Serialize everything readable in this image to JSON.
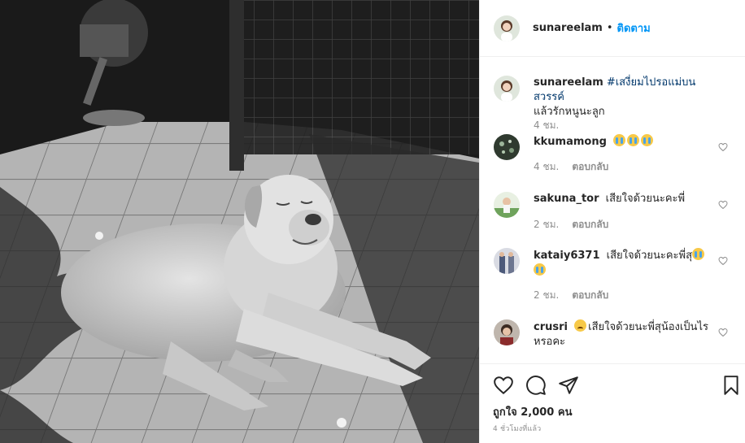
{
  "post": {
    "author": "sunareelam",
    "separator": "•",
    "follow_label": "ติดตาม",
    "caption": {
      "username": "sunareelam",
      "hashtag_line1": "#เสงี่ยมไปรอแม่บนสวรรค์",
      "line2": "แล้วรักหนูนะลูก",
      "time": "4 ชม."
    },
    "likes_text": "ถูกใจ 2,000 คน",
    "posted_ago": "4 ชั่วโมงที่แล้ว"
  },
  "comments": [
    {
      "username": "kkumamong",
      "text": "",
      "emojis": [
        "cry",
        "cry",
        "cry"
      ],
      "time": "4 ชม.",
      "reply_label": "ตอบกลับ"
    },
    {
      "username": "sakuna_tor",
      "text": "เสียใจด้วยนะคะพี่",
      "emojis": [],
      "time": "2 ชม.",
      "reply_label": "ตอบกลับ"
    },
    {
      "username": "kataiy6371",
      "text": "เสียใจด้วยนะคะพี่สุ",
      "emojis": [
        "cry",
        "cry"
      ],
      "time": "2 ชม.",
      "reply_label": "ตอบกลับ"
    },
    {
      "username": "crusri",
      "text_line1": "เสียใจด้วยนะพี่สุน้องเป็นไร",
      "text_line2": "หรอคะ",
      "emojis": [
        "sad"
      ]
    }
  ],
  "icons": {
    "like": "heart-icon",
    "comment": "comment-bubble-icon",
    "share": "paper-plane-icon",
    "save": "bookmark-icon",
    "comment_like": "small-heart-icon"
  },
  "colors": {
    "link_blue": "#0095f6",
    "hashtag": "#00376b",
    "muted": "#8e8e8e",
    "border": "#efefef"
  }
}
